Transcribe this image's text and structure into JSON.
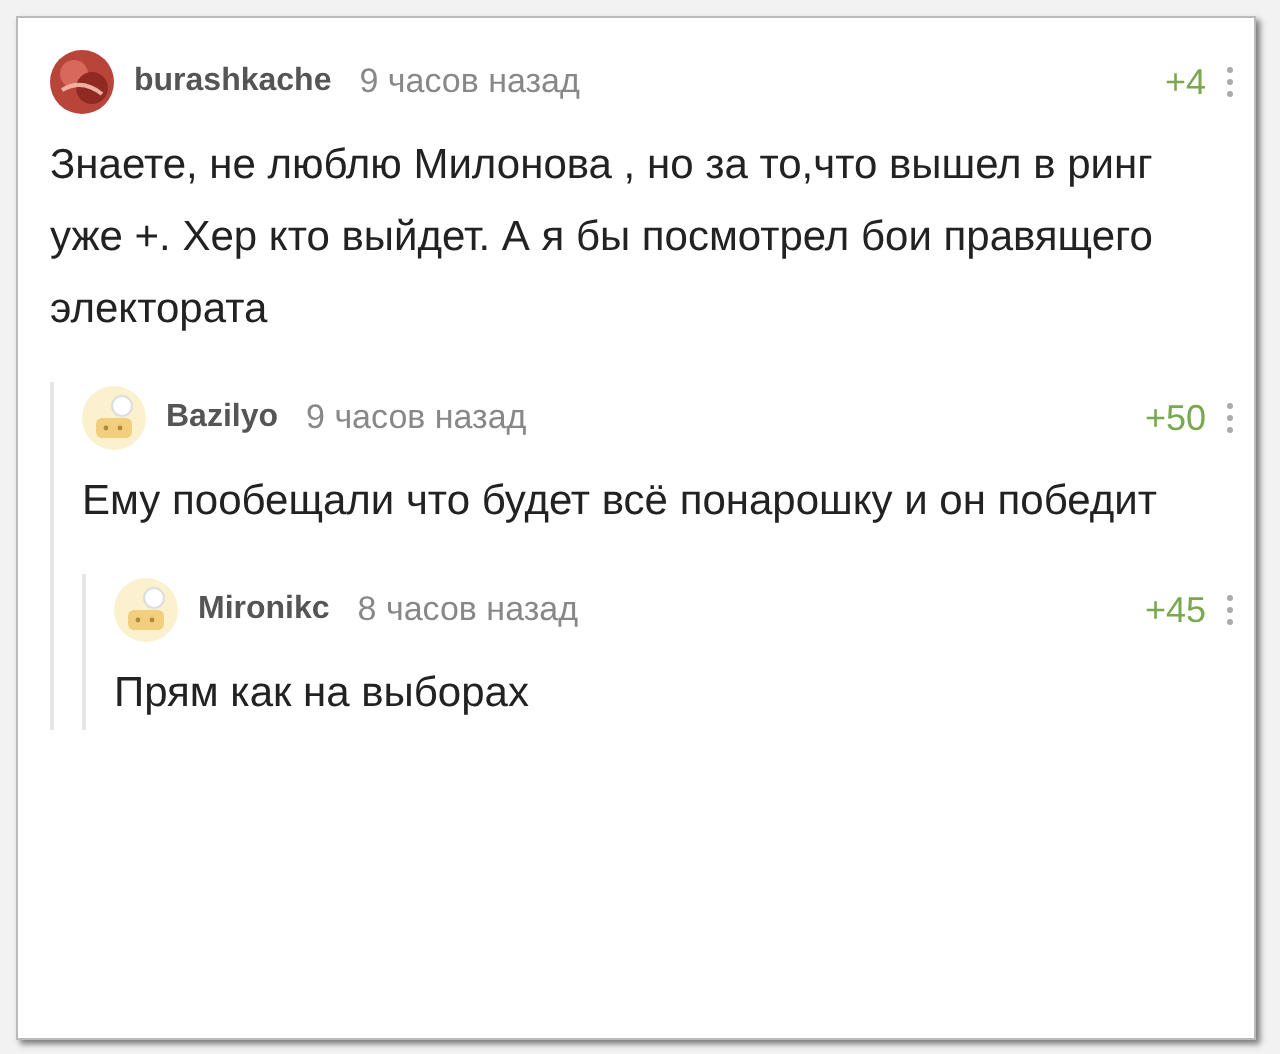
{
  "comments": [
    {
      "author": "burashkache",
      "time": "9 часов назад",
      "score": "+4",
      "avatar": {
        "kind": "photo"
      },
      "text": "Знаете, не люблю Милонова , но за то,что вышел в ринг уже +. Хер кто выйдет. А я бы посмотрел бои правящего электората",
      "children": [
        {
          "author": "Bazilyo",
          "time": "9 часов назад",
          "score": "+50",
          "avatar": {
            "kind": "cartoon"
          },
          "text": "Ему пообещали что будет всё понарошку и он победит",
          "children": [
            {
              "author": "Mironikc",
              "time": "8 часов назад",
              "score": "+45",
              "avatar": {
                "kind": "cartoon"
              },
              "text": "Прям как на выборах"
            }
          ]
        }
      ]
    }
  ]
}
